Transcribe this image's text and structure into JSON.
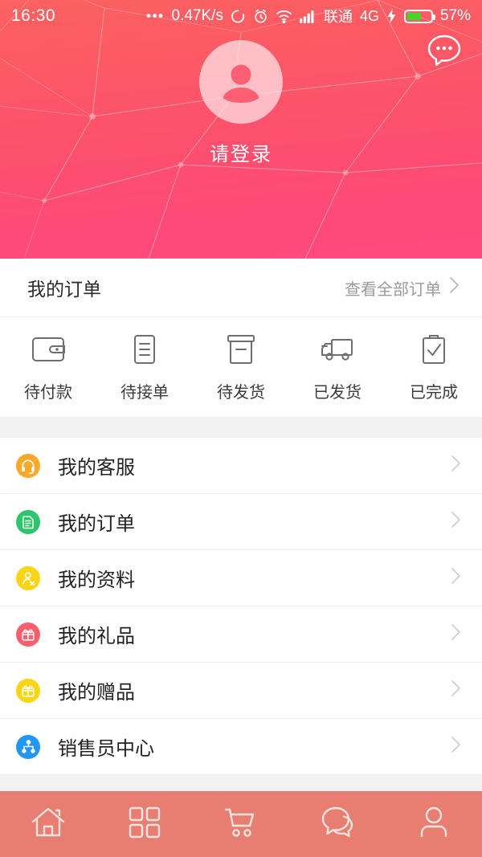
{
  "statusbar": {
    "time": "16:30",
    "dots": "•••",
    "network_speed": "0.47K/s",
    "carrier": "联通",
    "network_type": "4G",
    "battery_percent": "57%",
    "icons": [
      "sync-icon",
      "alarm-icon",
      "wifi-icon",
      "signal-icon",
      "charging-icon",
      "battery-icon"
    ]
  },
  "header": {
    "chat_button": "chat-bubble-icon",
    "avatar": "user-avatar-placeholder",
    "login_text": "请登录",
    "gradient_top": "#FB6260",
    "gradient_bottom": "#FE4A7D"
  },
  "orders": {
    "title": "我的订单",
    "view_all": "查看全部订单",
    "chevron": "chevron-right-icon",
    "statuses": [
      {
        "label": "待付款",
        "icon": "wallet-icon"
      },
      {
        "label": "待接单",
        "icon": "document-lines-icon"
      },
      {
        "label": "待发货",
        "icon": "box-icon"
      },
      {
        "label": "已发货",
        "icon": "truck-icon"
      },
      {
        "label": "已完成",
        "icon": "clipboard-check-icon"
      }
    ]
  },
  "menu": {
    "items": [
      {
        "label": "我的客服",
        "icon": "headset-icon",
        "color": "#F9A82A"
      },
      {
        "label": "我的订单",
        "icon": "document-icon",
        "color": "#2CC56B"
      },
      {
        "label": "我的资料",
        "icon": "profile-icon",
        "color": "#FAD517"
      },
      {
        "label": "我的礼品",
        "icon": "gift-icon",
        "color": "#FB5F6E"
      },
      {
        "label": "我的赠品",
        "icon": "gift-icon",
        "color": "#FAD517"
      },
      {
        "label": "销售员中心",
        "icon": "network-icon",
        "color": "#2196F3"
      }
    ]
  },
  "bottom_nav": {
    "background": "#E87E71",
    "items": [
      {
        "icon": "home-icon"
      },
      {
        "icon": "grid-icon"
      },
      {
        "icon": "cart-icon"
      },
      {
        "icon": "chat-icon"
      },
      {
        "icon": "person-icon"
      }
    ]
  }
}
